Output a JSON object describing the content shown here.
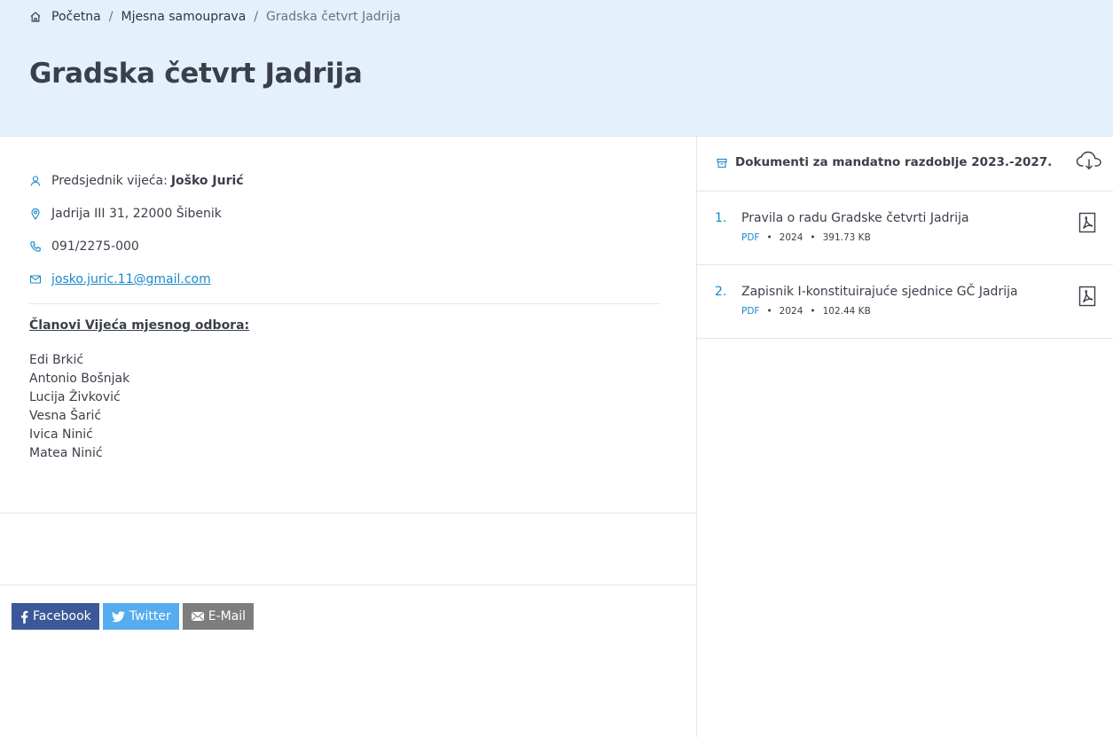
{
  "breadcrumb": {
    "home_icon": "home-icon",
    "items": [
      "Početna",
      "Mjesna samouprava"
    ],
    "separator": "/",
    "current": "Gradska četvrt Jadrija"
  },
  "page": {
    "title": "Gradska četvrt Jadrija"
  },
  "info": {
    "president_label": "Predsjednik vijeća:",
    "president_name": "Joško Jurić",
    "address": "Jadrija III 31, 22000 Šibenik",
    "phone": "091/2275-000",
    "email": "josko.juric.11@gmail.com"
  },
  "members": {
    "heading": "Članovi Vijeća mjesnog odbora:",
    "list": [
      "Edi Brkić",
      "Antonio Bošnjak",
      "Lucija Živković",
      "Vesna Šarić",
      "Ivica Ninić",
      "Matea Ninić"
    ]
  },
  "share": {
    "facebook": "Facebook",
    "twitter": "Twitter",
    "email": "E-Mail",
    "colors": {
      "facebook": "#3b5998",
      "twitter": "#55acee",
      "email": "#7d7d7d"
    }
  },
  "documents": {
    "heading": "Dokumenti za mandatno razdoblje 2023.-2027.",
    "items": [
      {
        "number": "1.",
        "name": "Pravila o radu Gradske četvrti Jadrija",
        "type": "PDF",
        "year": "2024",
        "size": "391.73 KB"
      },
      {
        "number": "2.",
        "name": "Zapisnik I-konstituirajuće sjednice GČ Jadrija",
        "type": "PDF",
        "year": "2024",
        "size": "102.44 KB"
      }
    ]
  },
  "colors": {
    "accent": "#1a88c9",
    "hero_bg": "#e4f1fc",
    "text": "#3a3f4a"
  }
}
